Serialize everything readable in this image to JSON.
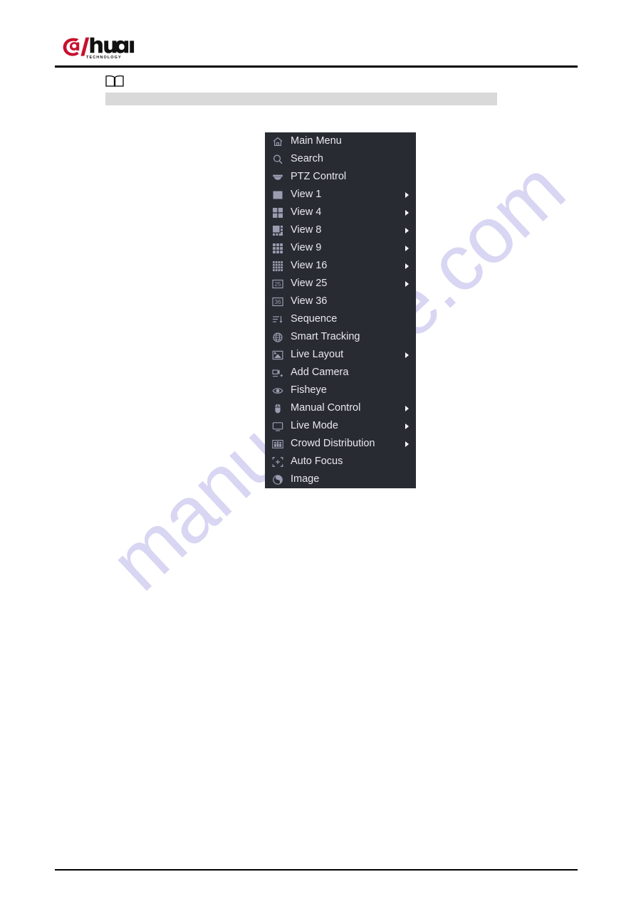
{
  "page": {
    "brand_name": "alhua",
    "brand_tagline": "TECHNOLOGY",
    "watermark_text": "manualslive.com",
    "note_icon_name": "note-book-icon",
    "note_text": ""
  },
  "context_menu": {
    "background_color": "#292b33",
    "text_color": "#e8e9ef",
    "items": [
      {
        "label": "Main Menu",
        "icon": "home-icon",
        "has_submenu": false
      },
      {
        "label": "Search",
        "icon": "search-icon",
        "has_submenu": false
      },
      {
        "label": "PTZ Control",
        "icon": "ptz-dome-icon",
        "has_submenu": false
      },
      {
        "label": "View 1",
        "icon": "view-1-icon",
        "has_submenu": true
      },
      {
        "label": "View 4",
        "icon": "view-4-icon",
        "has_submenu": true
      },
      {
        "label": "View 8",
        "icon": "view-8-icon",
        "has_submenu": true
      },
      {
        "label": "View 9",
        "icon": "view-9-icon",
        "has_submenu": true
      },
      {
        "label": "View 16",
        "icon": "view-16-icon",
        "has_submenu": true
      },
      {
        "label": "View 25",
        "icon": "view-25-icon",
        "has_submenu": true
      },
      {
        "label": "View 36",
        "icon": "view-36-icon",
        "has_submenu": false
      },
      {
        "label": "Sequence",
        "icon": "sequence-icon",
        "has_submenu": false
      },
      {
        "label": "Smart Tracking",
        "icon": "smart-tracking-icon",
        "has_submenu": false
      },
      {
        "label": "Live Layout",
        "icon": "live-layout-icon",
        "has_submenu": true
      },
      {
        "label": "Add Camera",
        "icon": "add-camera-icon",
        "has_submenu": false
      },
      {
        "label": "Fisheye",
        "icon": "fisheye-eye-icon",
        "has_submenu": false
      },
      {
        "label": "Manual Control",
        "icon": "mouse-icon",
        "has_submenu": true
      },
      {
        "label": "Live Mode",
        "icon": "monitor-icon",
        "has_submenu": true
      },
      {
        "label": "Crowd Distribution",
        "icon": "crowd-distribution-icon",
        "has_submenu": true
      },
      {
        "label": "Auto Focus",
        "icon": "auto-focus-icon",
        "has_submenu": false
      },
      {
        "label": "Image",
        "icon": "image-icon",
        "has_submenu": false
      }
    ]
  }
}
